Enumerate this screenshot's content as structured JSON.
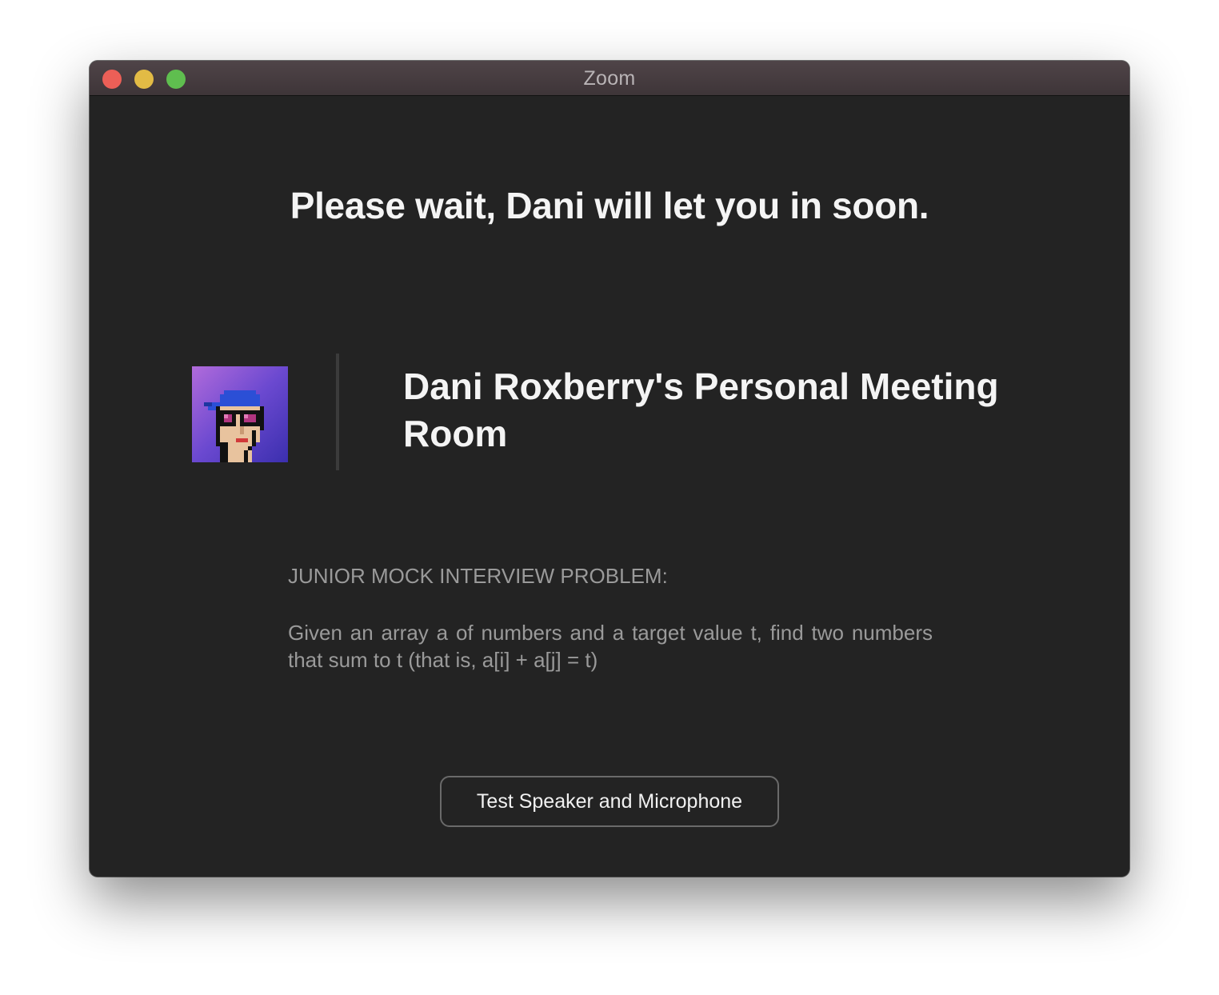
{
  "window": {
    "title": "Zoom"
  },
  "waiting": {
    "heading": "Please wait, Dani will let you in soon."
  },
  "meeting": {
    "room_name": "Dani Roxberry's Personal Meeting Room",
    "avatar_icon": "pixel-avatar-icon"
  },
  "description": {
    "heading": "JUNIOR MOCK INTERVIEW PROBLEM:",
    "body": "Given an array a of numbers and a target value t, find two numbers that sum to t (that is, a[i] + a[j] = t)"
  },
  "actions": {
    "test_audio_label": "Test Speaker and Microphone"
  },
  "colors": {
    "window_bg": "#232323",
    "titlebar": "#4a3f43",
    "close": "#ec5f57",
    "minimize": "#e2bb45",
    "maximize": "#5fbe4f",
    "avatar_gradient_start": "#b16bdb",
    "avatar_gradient_end": "#3b2fae"
  }
}
